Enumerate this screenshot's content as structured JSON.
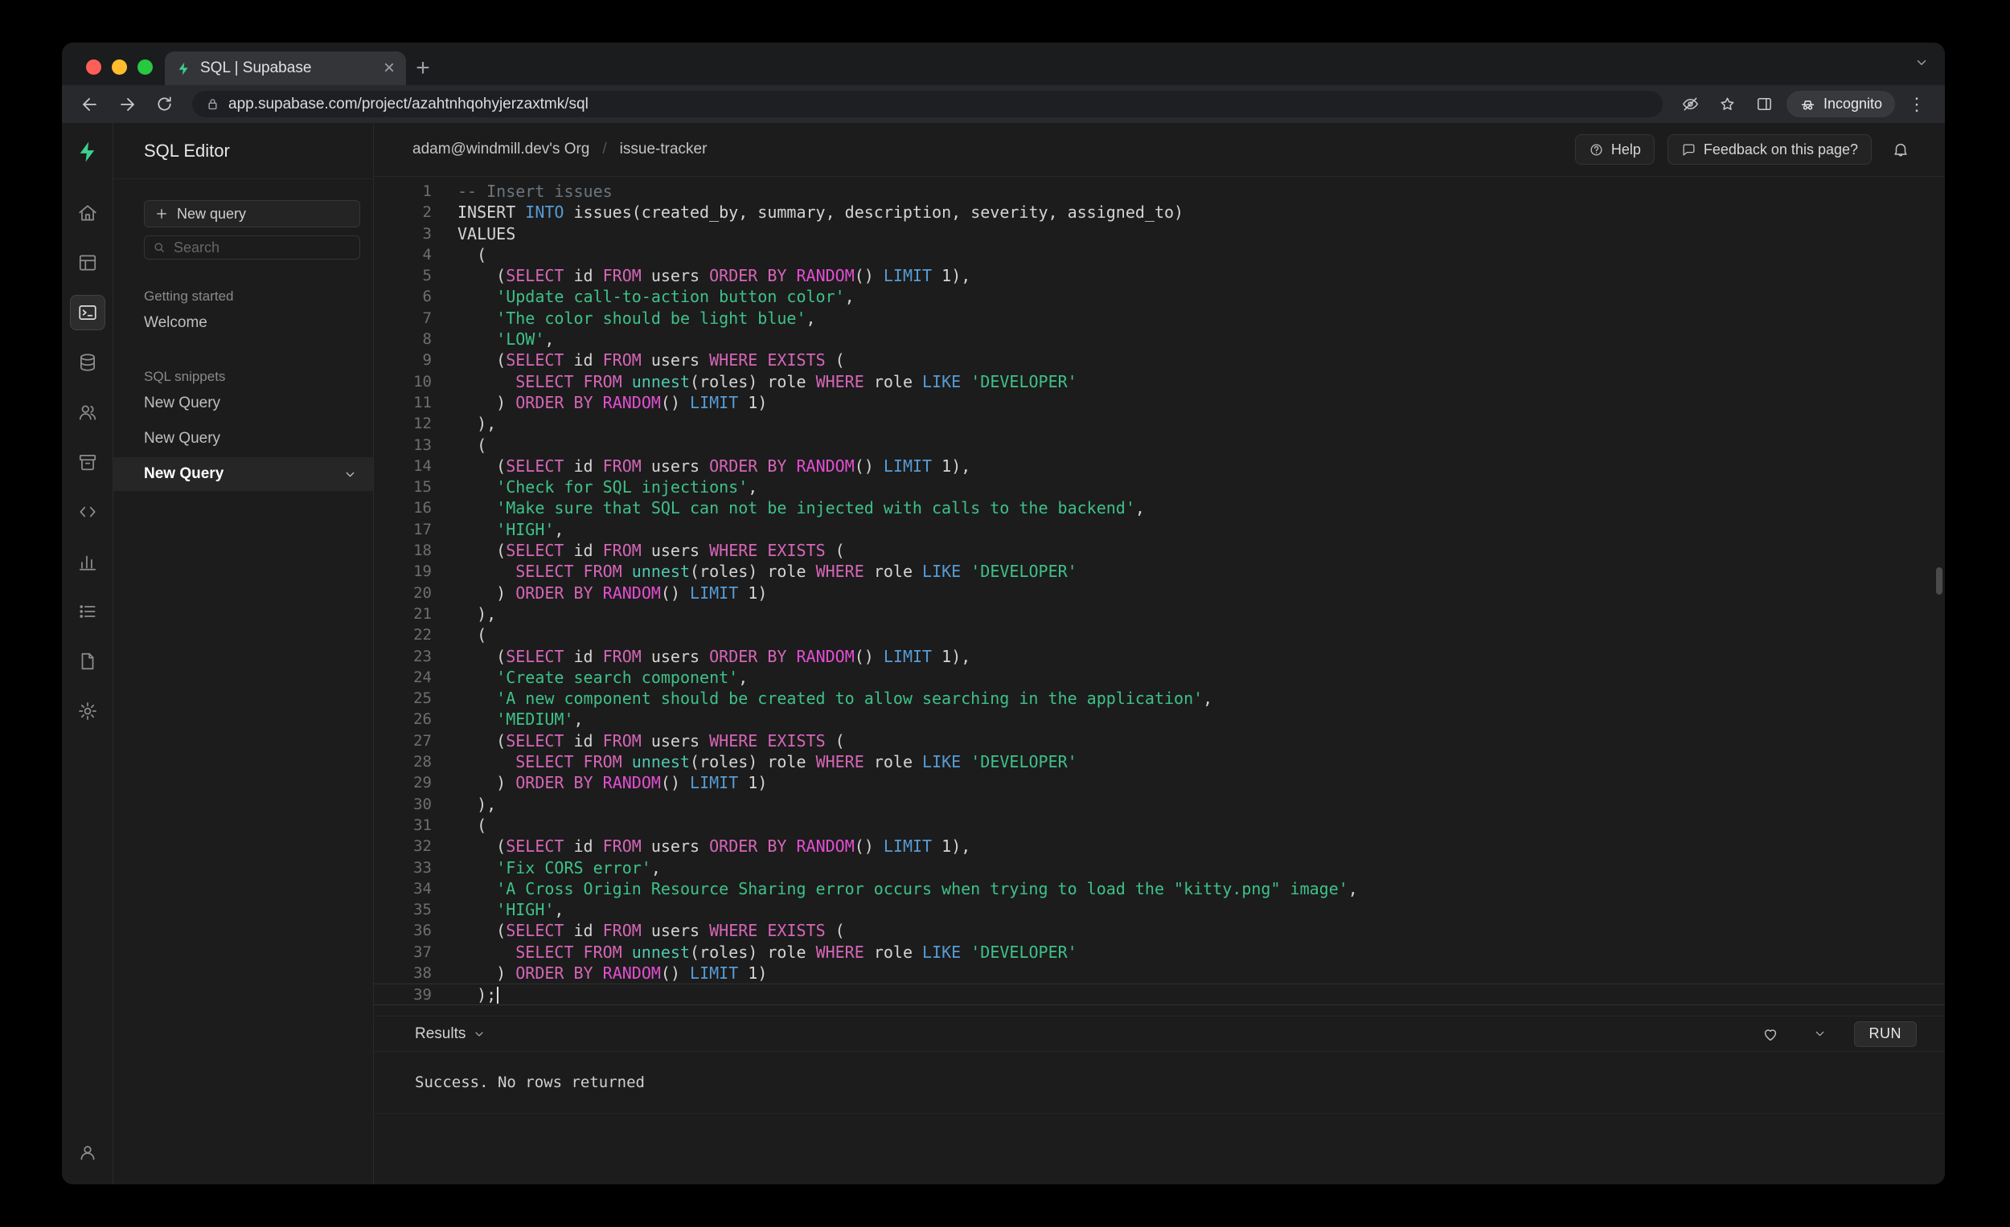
{
  "browser": {
    "tab": {
      "title": "SQL | Supabase"
    },
    "address": {
      "url": "app.supabase.com/project/azahtnhqohyjerzaxtmk/sql"
    },
    "incognito_label": "Incognito",
    "glyphs": {
      "close_tab": "×",
      "new_tab": "+",
      "kebab": "⋮"
    }
  },
  "app": {
    "sidebar": {
      "title": "SQL Editor",
      "new_query": "New query",
      "search_placeholder": "Search",
      "section1": {
        "label": "Getting started",
        "items": [
          "Welcome"
        ]
      },
      "section2": {
        "label": "SQL snippets",
        "items": [
          "New Query",
          "New Query",
          "New Query"
        ],
        "selected_index": 2
      }
    },
    "header": {
      "org": "adam@windmill.dev's Org",
      "separator": "/",
      "project": "issue-tracker",
      "help": "Help",
      "feedback": "Feedback on this page?"
    },
    "results": {
      "label": "Results",
      "run": "RUN",
      "message": "Success. No rows returned"
    }
  },
  "colors": {
    "brand_green": "#3ecf8e",
    "keyword": "#d666b8",
    "function": "#e44fd4",
    "operator": "#569cd6",
    "string": "#3ec189",
    "builtin": "#4ec9b0",
    "comment": "#6c757d"
  },
  "editor": {
    "lines": [
      {
        "n": 1,
        "t": [
          [
            "-- Insert issues",
            "c"
          ]
        ]
      },
      {
        "n": 2,
        "t": [
          [
            "INSERT ",
            "d"
          ],
          [
            "INTO",
            "o"
          ],
          [
            " issues(created_by, summary, description, severity, assigned_to)",
            "d"
          ]
        ]
      },
      {
        "n": 3,
        "t": [
          [
            "VALUES",
            "d"
          ]
        ]
      },
      {
        "n": 4,
        "t": [
          [
            "  (",
            "d"
          ]
        ]
      },
      {
        "n": 5,
        "t": [
          [
            "    (",
            "d"
          ],
          [
            "SELECT",
            "k"
          ],
          [
            " id ",
            "d"
          ],
          [
            "FROM",
            "k"
          ],
          [
            " users ",
            "d"
          ],
          [
            "ORDER",
            "k"
          ],
          [
            " ",
            "d"
          ],
          [
            "BY",
            "k"
          ],
          [
            " ",
            "d"
          ],
          [
            "RANDOM",
            "f"
          ],
          [
            "() ",
            "d"
          ],
          [
            "LIMIT",
            "o"
          ],
          [
            " 1),",
            "d"
          ]
        ]
      },
      {
        "n": 6,
        "t": [
          [
            "    ",
            "d"
          ],
          [
            "'Update call-to-action button color'",
            "s"
          ],
          [
            ",",
            "d"
          ]
        ]
      },
      {
        "n": 7,
        "t": [
          [
            "    ",
            "d"
          ],
          [
            "'The color should be light blue'",
            "s"
          ],
          [
            ",",
            "d"
          ]
        ]
      },
      {
        "n": 8,
        "t": [
          [
            "    ",
            "d"
          ],
          [
            "'LOW'",
            "s"
          ],
          [
            ",",
            "d"
          ]
        ]
      },
      {
        "n": 9,
        "t": [
          [
            "    (",
            "d"
          ],
          [
            "SELECT",
            "k"
          ],
          [
            " id ",
            "d"
          ],
          [
            "FROM",
            "k"
          ],
          [
            " users ",
            "d"
          ],
          [
            "WHERE",
            "k"
          ],
          [
            " ",
            "d"
          ],
          [
            "EXISTS",
            "k"
          ],
          [
            " (",
            "d"
          ]
        ]
      },
      {
        "n": 10,
        "t": [
          [
            "      ",
            "d"
          ],
          [
            "SELECT",
            "k"
          ],
          [
            " ",
            "d"
          ],
          [
            "FROM",
            "k"
          ],
          [
            " ",
            "d"
          ],
          [
            "unnest",
            "t"
          ],
          [
            "(roles) role ",
            "d"
          ],
          [
            "WHERE",
            "k"
          ],
          [
            " role ",
            "d"
          ],
          [
            "LIKE",
            "o"
          ],
          [
            " ",
            "d"
          ],
          [
            "'DEVELOPER'",
            "s"
          ]
        ]
      },
      {
        "n": 11,
        "t": [
          [
            "    ) ",
            "d"
          ],
          [
            "ORDER",
            "k"
          ],
          [
            " ",
            "d"
          ],
          [
            "BY",
            "k"
          ],
          [
            " ",
            "d"
          ],
          [
            "RANDOM",
            "f"
          ],
          [
            "() ",
            "d"
          ],
          [
            "LIMIT",
            "o"
          ],
          [
            " 1)",
            "d"
          ]
        ]
      },
      {
        "n": 12,
        "t": [
          [
            "  ),",
            "d"
          ]
        ]
      },
      {
        "n": 13,
        "t": [
          [
            "  (",
            "d"
          ]
        ]
      },
      {
        "n": 14,
        "t": [
          [
            "    (",
            "d"
          ],
          [
            "SELECT",
            "k"
          ],
          [
            " id ",
            "d"
          ],
          [
            "FROM",
            "k"
          ],
          [
            " users ",
            "d"
          ],
          [
            "ORDER",
            "k"
          ],
          [
            " ",
            "d"
          ],
          [
            "BY",
            "k"
          ],
          [
            " ",
            "d"
          ],
          [
            "RANDOM",
            "f"
          ],
          [
            "() ",
            "d"
          ],
          [
            "LIMIT",
            "o"
          ],
          [
            " 1),",
            "d"
          ]
        ]
      },
      {
        "n": 15,
        "t": [
          [
            "    ",
            "d"
          ],
          [
            "'Check for SQL injections'",
            "s"
          ],
          [
            ",",
            "d"
          ]
        ]
      },
      {
        "n": 16,
        "t": [
          [
            "    ",
            "d"
          ],
          [
            "'Make sure that SQL can not be injected with calls to the backend'",
            "s"
          ],
          [
            ",",
            "d"
          ]
        ]
      },
      {
        "n": 17,
        "t": [
          [
            "    ",
            "d"
          ],
          [
            "'HIGH'",
            "s"
          ],
          [
            ",",
            "d"
          ]
        ]
      },
      {
        "n": 18,
        "t": [
          [
            "    (",
            "d"
          ],
          [
            "SELECT",
            "k"
          ],
          [
            " id ",
            "d"
          ],
          [
            "FROM",
            "k"
          ],
          [
            " users ",
            "d"
          ],
          [
            "WHERE",
            "k"
          ],
          [
            " ",
            "d"
          ],
          [
            "EXISTS",
            "k"
          ],
          [
            " (",
            "d"
          ]
        ]
      },
      {
        "n": 19,
        "t": [
          [
            "      ",
            "d"
          ],
          [
            "SELECT",
            "k"
          ],
          [
            " ",
            "d"
          ],
          [
            "FROM",
            "k"
          ],
          [
            " ",
            "d"
          ],
          [
            "unnest",
            "t"
          ],
          [
            "(roles) role ",
            "d"
          ],
          [
            "WHERE",
            "k"
          ],
          [
            " role ",
            "d"
          ],
          [
            "LIKE",
            "o"
          ],
          [
            " ",
            "d"
          ],
          [
            "'DEVELOPER'",
            "s"
          ]
        ]
      },
      {
        "n": 20,
        "t": [
          [
            "    ) ",
            "d"
          ],
          [
            "ORDER",
            "k"
          ],
          [
            " ",
            "d"
          ],
          [
            "BY",
            "k"
          ],
          [
            " ",
            "d"
          ],
          [
            "RANDOM",
            "f"
          ],
          [
            "() ",
            "d"
          ],
          [
            "LIMIT",
            "o"
          ],
          [
            " 1)",
            "d"
          ]
        ]
      },
      {
        "n": 21,
        "t": [
          [
            "  ),",
            "d"
          ]
        ]
      },
      {
        "n": 22,
        "t": [
          [
            "  (",
            "d"
          ]
        ]
      },
      {
        "n": 23,
        "t": [
          [
            "    (",
            "d"
          ],
          [
            "SELECT",
            "k"
          ],
          [
            " id ",
            "d"
          ],
          [
            "FROM",
            "k"
          ],
          [
            " users ",
            "d"
          ],
          [
            "ORDER",
            "k"
          ],
          [
            " ",
            "d"
          ],
          [
            "BY",
            "k"
          ],
          [
            " ",
            "d"
          ],
          [
            "RANDOM",
            "f"
          ],
          [
            "() ",
            "d"
          ],
          [
            "LIMIT",
            "o"
          ],
          [
            " 1),",
            "d"
          ]
        ]
      },
      {
        "n": 24,
        "t": [
          [
            "    ",
            "d"
          ],
          [
            "'Create search component'",
            "s"
          ],
          [
            ",",
            "d"
          ]
        ]
      },
      {
        "n": 25,
        "t": [
          [
            "    ",
            "d"
          ],
          [
            "'A new component should be created to allow searching in the application'",
            "s"
          ],
          [
            ",",
            "d"
          ]
        ]
      },
      {
        "n": 26,
        "t": [
          [
            "    ",
            "d"
          ],
          [
            "'MEDIUM'",
            "s"
          ],
          [
            ",",
            "d"
          ]
        ]
      },
      {
        "n": 27,
        "t": [
          [
            "    (",
            "d"
          ],
          [
            "SELECT",
            "k"
          ],
          [
            " id ",
            "d"
          ],
          [
            "FROM",
            "k"
          ],
          [
            " users ",
            "d"
          ],
          [
            "WHERE",
            "k"
          ],
          [
            " ",
            "d"
          ],
          [
            "EXISTS",
            "k"
          ],
          [
            " (",
            "d"
          ]
        ]
      },
      {
        "n": 28,
        "t": [
          [
            "      ",
            "d"
          ],
          [
            "SELECT",
            "k"
          ],
          [
            " ",
            "d"
          ],
          [
            "FROM",
            "k"
          ],
          [
            " ",
            "d"
          ],
          [
            "unnest",
            "t"
          ],
          [
            "(roles) role ",
            "d"
          ],
          [
            "WHERE",
            "k"
          ],
          [
            " role ",
            "d"
          ],
          [
            "LIKE",
            "o"
          ],
          [
            " ",
            "d"
          ],
          [
            "'DEVELOPER'",
            "s"
          ]
        ]
      },
      {
        "n": 29,
        "t": [
          [
            "    ) ",
            "d"
          ],
          [
            "ORDER",
            "k"
          ],
          [
            " ",
            "d"
          ],
          [
            "BY",
            "k"
          ],
          [
            " ",
            "d"
          ],
          [
            "RANDOM",
            "f"
          ],
          [
            "() ",
            "d"
          ],
          [
            "LIMIT",
            "o"
          ],
          [
            " 1)",
            "d"
          ]
        ]
      },
      {
        "n": 30,
        "t": [
          [
            "  ),",
            "d"
          ]
        ]
      },
      {
        "n": 31,
        "t": [
          [
            "  (",
            "d"
          ]
        ]
      },
      {
        "n": 32,
        "t": [
          [
            "    (",
            "d"
          ],
          [
            "SELECT",
            "k"
          ],
          [
            " id ",
            "d"
          ],
          [
            "FROM",
            "k"
          ],
          [
            " users ",
            "d"
          ],
          [
            "ORDER",
            "k"
          ],
          [
            " ",
            "d"
          ],
          [
            "BY",
            "k"
          ],
          [
            " ",
            "d"
          ],
          [
            "RANDOM",
            "f"
          ],
          [
            "() ",
            "d"
          ],
          [
            "LIMIT",
            "o"
          ],
          [
            " 1),",
            "d"
          ]
        ]
      },
      {
        "n": 33,
        "t": [
          [
            "    ",
            "d"
          ],
          [
            "'Fix CORS error'",
            "s"
          ],
          [
            ",",
            "d"
          ]
        ]
      },
      {
        "n": 34,
        "t": [
          [
            "    ",
            "d"
          ],
          [
            "'A Cross Origin Resource Sharing error occurs when trying to load the \"kitty.png\" image'",
            "s"
          ],
          [
            ",",
            "d"
          ]
        ]
      },
      {
        "n": 35,
        "t": [
          [
            "    ",
            "d"
          ],
          [
            "'HIGH'",
            "s"
          ],
          [
            ",",
            "d"
          ]
        ]
      },
      {
        "n": 36,
        "t": [
          [
            "    (",
            "d"
          ],
          [
            "SELECT",
            "k"
          ],
          [
            " id ",
            "d"
          ],
          [
            "FROM",
            "k"
          ],
          [
            " users ",
            "d"
          ],
          [
            "WHERE",
            "k"
          ],
          [
            " ",
            "d"
          ],
          [
            "EXISTS",
            "k"
          ],
          [
            " (",
            "d"
          ]
        ]
      },
      {
        "n": 37,
        "t": [
          [
            "      ",
            "d"
          ],
          [
            "SELECT",
            "k"
          ],
          [
            " ",
            "d"
          ],
          [
            "FROM",
            "k"
          ],
          [
            " ",
            "d"
          ],
          [
            "unnest",
            "t"
          ],
          [
            "(roles) role ",
            "d"
          ],
          [
            "WHERE",
            "k"
          ],
          [
            " role ",
            "d"
          ],
          [
            "LIKE",
            "o"
          ],
          [
            " ",
            "d"
          ],
          [
            "'DEVELOPER'",
            "s"
          ]
        ]
      },
      {
        "n": 38,
        "t": [
          [
            "    ) ",
            "d"
          ],
          [
            "ORDER",
            "k"
          ],
          [
            " ",
            "d"
          ],
          [
            "BY",
            "k"
          ],
          [
            " ",
            "d"
          ],
          [
            "RANDOM",
            "f"
          ],
          [
            "() ",
            "d"
          ],
          [
            "LIMIT",
            "o"
          ],
          [
            " 1)",
            "d"
          ]
        ]
      },
      {
        "n": 39,
        "t": [
          [
            "  );",
            "d"
          ]
        ],
        "active": true,
        "cursor": true
      }
    ]
  }
}
